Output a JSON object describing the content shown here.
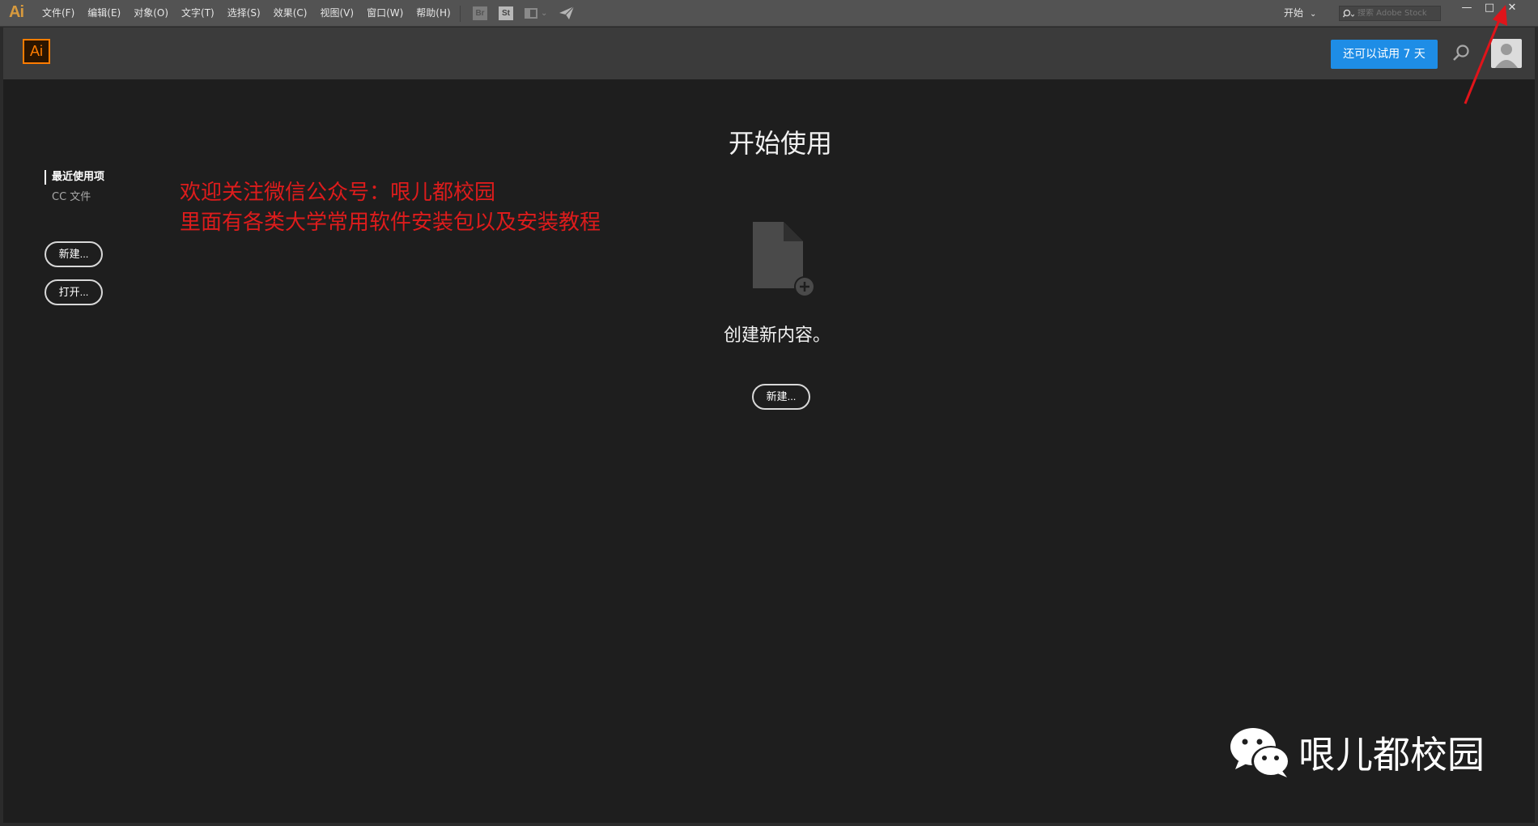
{
  "menubar": {
    "app_glyph": "Ai",
    "items": [
      "文件(F)",
      "编辑(E)",
      "对象(O)",
      "文字(T)",
      "选择(S)",
      "效果(C)",
      "视图(V)",
      "窗口(W)",
      "帮助(H)"
    ],
    "toolbar": {
      "br_label": "Br",
      "st_label": "St"
    },
    "workspace_label": "开始",
    "stock_placeholder": "搜索 Adobe Stock",
    "window_controls": {
      "minimize": "—",
      "maximize": "□",
      "close": "✕"
    }
  },
  "header": {
    "logo_text": "Ai",
    "trial_button": "还可以试用 7 天"
  },
  "sidebar": {
    "recent_label": "最近使用项",
    "cc_label": "CC 文件",
    "new_button": "新建...",
    "open_button": "打开..."
  },
  "notice": {
    "line1": "欢迎关注微信公众号：哏儿都校园",
    "line2": "里面有各类大学常用软件安装包以及安装教程"
  },
  "main": {
    "title": "开始使用",
    "create_text": "创建新内容。",
    "new_button": "新建..."
  },
  "watermark": {
    "name": "哏儿都校园"
  },
  "colors": {
    "accent_blue": "#1e8de6",
    "ai_orange": "#ff7c00",
    "notice_red": "#dd1c1c"
  }
}
